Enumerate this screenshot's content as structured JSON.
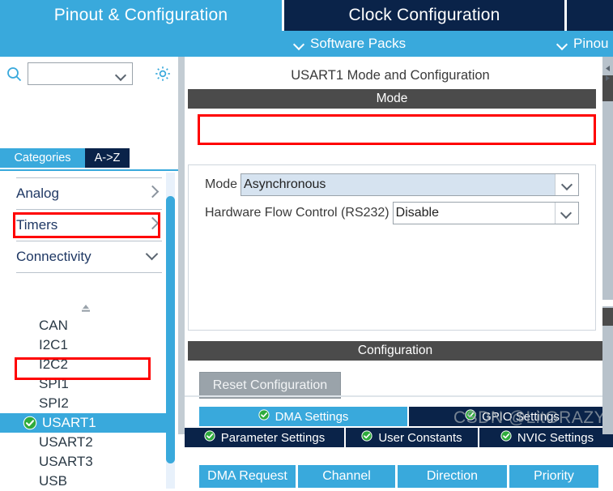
{
  "app": {
    "main_tabs": [
      {
        "label": "Pinout & Configuration",
        "state": "active"
      },
      {
        "label": "Clock Configuration",
        "state": "inactive"
      }
    ],
    "sub_bar": [
      {
        "label": "Software Packs",
        "icon": "chevron-down-icon"
      },
      {
        "label": "Pinou",
        "icon": "chevron-down-icon"
      }
    ]
  },
  "sidebar": {
    "search": {
      "value": "",
      "placeholder": "",
      "icon": "search-icon"
    },
    "gear": {
      "icon": "gear-icon"
    },
    "tabs": [
      {
        "label": "Categories",
        "state": "active"
      },
      {
        "label": "A->Z",
        "state": "inactive"
      }
    ],
    "categories": [
      {
        "label": "Analog",
        "arrow": "chevron-right-icon",
        "expanded": false
      },
      {
        "label": "Timers",
        "arrow": "chevron-right-icon",
        "expanded": false
      },
      {
        "label": "Connectivity",
        "arrow": "chevron-down-icon",
        "expanded": true,
        "highlighted": true
      }
    ],
    "peripherals": [
      {
        "label": "CAN",
        "selected": false,
        "configured": false
      },
      {
        "label": "I2C1",
        "selected": false,
        "configured": false
      },
      {
        "label": "I2C2",
        "selected": false,
        "configured": false
      },
      {
        "label": "SPI1",
        "selected": false,
        "configured": false
      },
      {
        "label": "SPI2",
        "selected": false,
        "configured": false
      },
      {
        "label": "USART1",
        "selected": true,
        "configured": true,
        "highlighted": true
      },
      {
        "label": "USART2",
        "selected": false,
        "configured": false
      },
      {
        "label": "USART3",
        "selected": false,
        "configured": false
      },
      {
        "label": "USB",
        "selected": false,
        "configured": false
      }
    ]
  },
  "main": {
    "title": "USART1 Mode and Configuration",
    "mode_section": {
      "header": "Mode",
      "fields": [
        {
          "label": "Mode",
          "value": "Asynchronous",
          "highlighted": true
        },
        {
          "label": "Hardware Flow Control (RS232)",
          "value": "Disable",
          "highlighted": false
        }
      ]
    },
    "configuration_section": {
      "header": "Configuration",
      "reset_button": "Reset Configuration",
      "tabs_row1": [
        {
          "label": "DMA Settings",
          "state": "active",
          "icon": "check-circle-icon"
        },
        {
          "label": "GPIO Settings",
          "state": "inactive",
          "icon": "check-circle-icon"
        }
      ],
      "tabs_row2": [
        {
          "label": "Parameter Settings",
          "state": "inactive",
          "icon": "check-circle-icon"
        },
        {
          "label": "User Constants",
          "state": "inactive",
          "icon": "check-circle-icon"
        },
        {
          "label": "NVIC Settings",
          "state": "inactive",
          "icon": "check-circle-icon"
        }
      ],
      "table_headers": [
        "DMA Request",
        "Channel",
        "Direction",
        "Priority"
      ]
    }
  },
  "watermark": {
    "text": "CSDN @LitGRAZY"
  },
  "colors": {
    "accent_blue": "#39a9dc",
    "dark_navy": "#0a2349",
    "section_gray": "#4b4b4b",
    "highlight_red": "#ff0000",
    "field_fill": "#d6e3f0",
    "button_gray": "#9aa3aa",
    "check_green": "#2eab3c"
  }
}
